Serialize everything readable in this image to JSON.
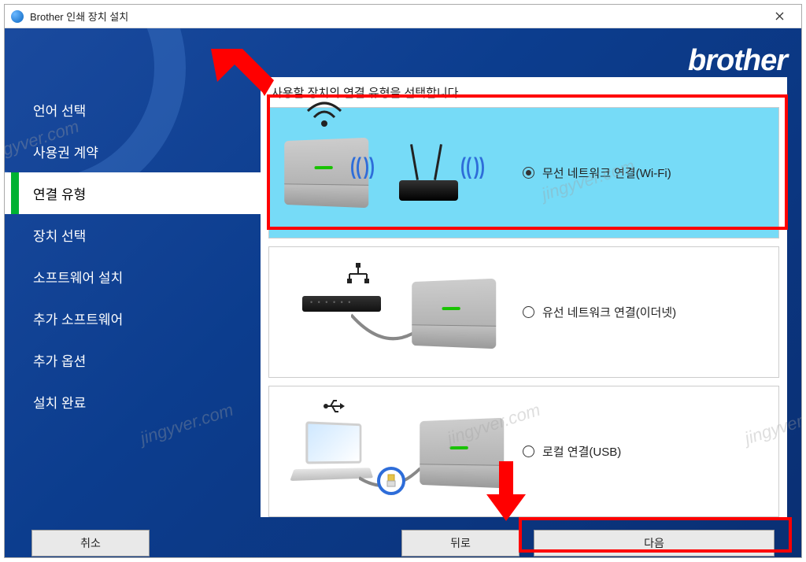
{
  "titlebar": {
    "title": "Brother 인쇄 장치 설치"
  },
  "brand": "brother",
  "sidebar": {
    "items": [
      {
        "label": "언어 선택"
      },
      {
        "label": "사용권 계약"
      },
      {
        "label": "연결 유형",
        "active": true
      },
      {
        "label": "장치 선택"
      },
      {
        "label": "소프트웨어 설치"
      },
      {
        "label": "추가 소프트웨어"
      },
      {
        "label": "추가 옵션"
      },
      {
        "label": "설치 완료"
      }
    ]
  },
  "panel": {
    "title": "사용할 장치의 연결 유형을 선택합니다.",
    "options": [
      {
        "label": "무선 네트워크 연결(Wi-Fi)",
        "selected": true
      },
      {
        "label": "유선 네트워크 연결(이더넷)",
        "selected": false
      },
      {
        "label": "로컬 연결(USB)",
        "selected": false
      }
    ]
  },
  "footer": {
    "cancel": "취소",
    "back": "뒤로",
    "next": "다음"
  },
  "watermark": "jingyver.com"
}
